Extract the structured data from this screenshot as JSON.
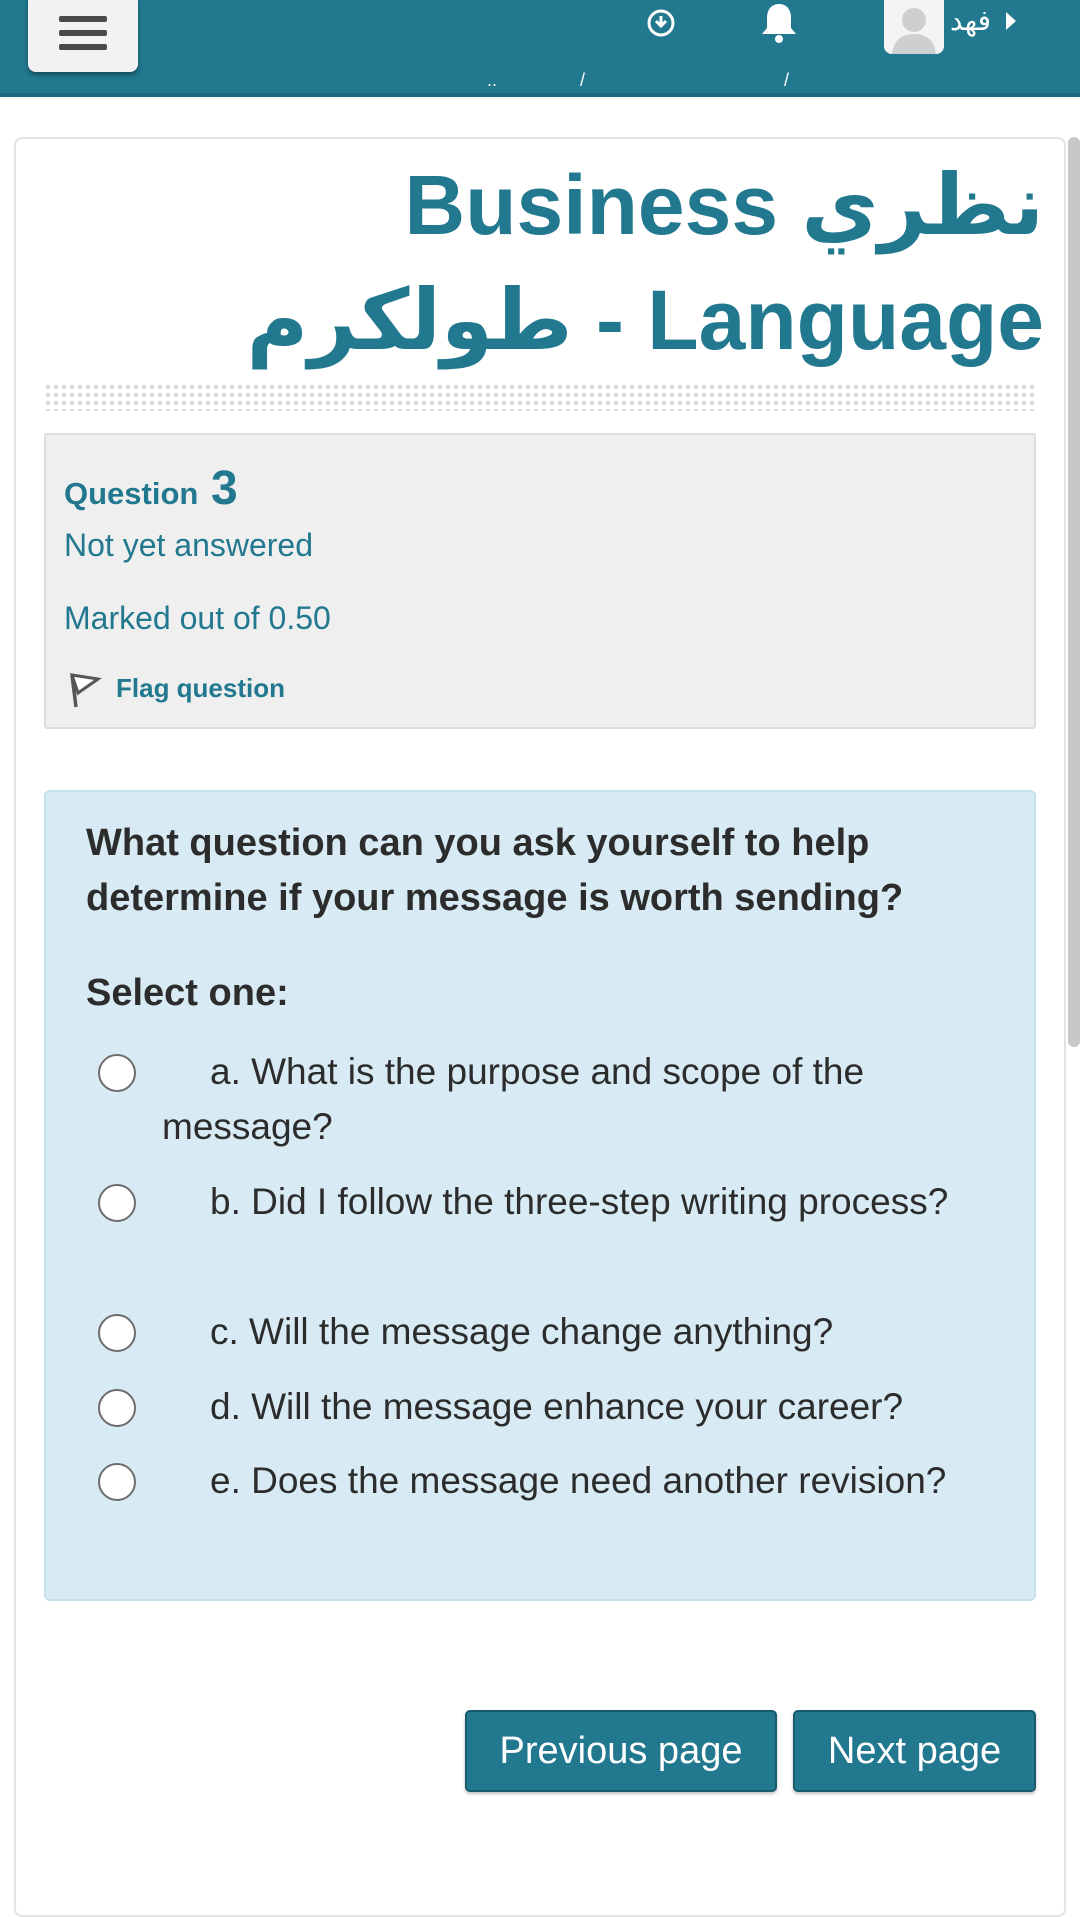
{
  "navbar": {
    "menu_icon": "hamburger-menu-icon",
    "download_icon": "download-circle-icon",
    "bell_icon": "bell-icon",
    "user_name": "فهد",
    "sub_marks": [
      "..",
      "/",
      "/"
    ],
    "colors": {
      "bar": "#21788f"
    }
  },
  "page": {
    "title": "نظري Business Language - طولكرم"
  },
  "question_info": {
    "label": "Question",
    "number": "3",
    "state": "Not yet answered",
    "grade": "Marked out of 0.50",
    "flag_label": "Flag question"
  },
  "question": {
    "text": "What question can you ask yourself to help determine if your message is worth sending?",
    "prompt": "Select one:",
    "options": [
      {
        "label": "a. What is the purpose and scope of the message?"
      },
      {
        "label": "b. Did I follow the three-step writing process?"
      },
      {
        "label": "c. Will the message change anything?"
      },
      {
        "label": "d. Will the message enhance your career?"
      },
      {
        "label": "e. Does the message need another revision?"
      }
    ]
  },
  "navigation": {
    "previous_label": "Previous page",
    "next_label": "Next page"
  }
}
